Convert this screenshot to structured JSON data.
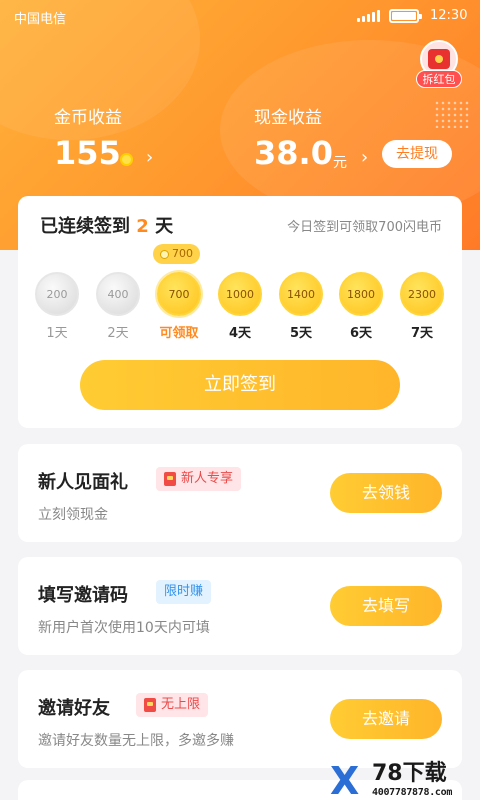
{
  "status_bar": {
    "carrier": "中国电信",
    "time": "12:30"
  },
  "red_packet": {
    "label": "拆红包",
    "icon": "red-envelope-icon"
  },
  "earnings": {
    "coin": {
      "label": "金币收益",
      "value": "155"
    },
    "cash": {
      "label": "现金收益",
      "value": "38.0",
      "unit": "元",
      "withdraw_label": "去提现"
    }
  },
  "signin": {
    "title_prefix": "已连续签到",
    "days_count": "2",
    "title_suffix": "天",
    "hint": "今日签到可领取700闪电币",
    "today_badge": "700",
    "days": [
      {
        "amount": "200",
        "label": "1天"
      },
      {
        "amount": "400",
        "label": "2天"
      },
      {
        "amount": "700",
        "label": "可领取"
      },
      {
        "amount": "1000",
        "label": "4天"
      },
      {
        "amount": "1400",
        "label": "5天"
      },
      {
        "amount": "1800",
        "label": "6天"
      },
      {
        "amount": "2300",
        "label": "7天"
      }
    ],
    "button_label": "立即签到"
  },
  "tasks": [
    {
      "title": "新人见面礼",
      "tag": "新人专享",
      "desc": "立刻领现金",
      "button": "去领钱"
    },
    {
      "title": "填写邀请码",
      "tag": "限时赚",
      "desc": "新用户首次使用10天内可填",
      "button": "去填写"
    },
    {
      "title": "邀请好友",
      "tag": "无上限",
      "desc": "邀请好友数量无上限，多邀多赚",
      "button": "去邀请"
    }
  ],
  "watermark": {
    "logo_x": "X",
    "name": "78下载",
    "url": "4007787878.com"
  },
  "colors": {
    "accent": "#ff8a1f",
    "button": "#ffbb2c",
    "header": "#ff9b2f"
  }
}
